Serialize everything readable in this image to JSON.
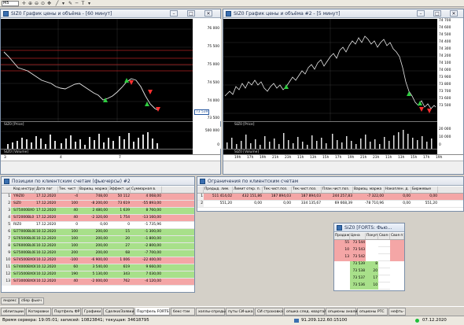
{
  "toolbar": {
    "interval": "M5"
  },
  "chart1": {
    "title": "SIZ0 График цены и объёма - [60 минут]",
    "price_ticks": [
      "76 000",
      "75 500",
      "75 000",
      "74 500",
      "74 000",
      "73 500"
    ],
    "last_price": "73 539",
    "price_label": "SIZ0 [Price]",
    "volume_ticks": [
      "500 000",
      "0"
    ],
    "volume_label": "SIZ0 [Volume]",
    "x_ticks": [
      "3",
      "4",
      "7"
    ]
  },
  "chart2": {
    "title": "SIZ0 График цены и объёма #2 - [5 минут]",
    "price_ticks": [
      "74 700",
      "74 600",
      "74 500",
      "74 400",
      "74 300",
      "74 200",
      "74 100",
      "74 000",
      "73 900",
      "73 800",
      "73 700",
      "73 600",
      "73 500"
    ],
    "price_label": "SIZ0 [Price]",
    "volume_ticks": [
      "20 000",
      "10 000",
      "0"
    ],
    "volume_label": "SIZ0 [Volume]",
    "x_ticks": [
      "19h",
      "17h",
      "19h",
      "21h",
      "23h",
      "11h",
      "13h",
      "15h",
      "17h",
      "19h",
      "21h",
      "23h",
      "11h",
      "13h",
      "15h",
      "17h",
      "19h"
    ]
  },
  "positions": {
    "title": "Позиции по клиентским счетам (фьючерсы) #2",
    "columns": [
      "Код инструм",
      "Дата пог",
      "Тек. чист",
      "Вариац. маржа",
      "Эффект. цена",
      "Суммарная в."
    ],
    "rows": [
      {
        "code": "Yl9ZI0",
        "date": "17.12.2020",
        "pos": "-4",
        "var": "748,00",
        "eff": "50 112",
        "sum": "4 068,00",
        "color": "red"
      },
      {
        "code": "SiZ0",
        "date": "17.12.2020",
        "pos": "100",
        "var": "-8 200,00",
        "eff": "73 619",
        "sum": "-55 893,00",
        "color": "red"
      },
      {
        "code": "Si75000BX0",
        "date": "17.12.2020",
        "pos": "40",
        "var": "2 480,00",
        "eff": "1 639",
        "sum": "8 760,00",
        "color": "green"
      },
      {
        "code": "Si72000BL0",
        "date": "17.12.2020",
        "pos": "40",
        "var": "-2 320,00",
        "eff": "1 754",
        "sum": "-13 160,00",
        "color": "red"
      },
      {
        "code": "RIZ0",
        "date": "17.12.2020",
        "pos": "0",
        "var": "0,00",
        "eff": "0",
        "sum": "-1 735,96",
        "color": "white"
      },
      {
        "code": "Si77000BL0B",
        "date": "10.12.2020",
        "pos": "100",
        "var": "200,00",
        "eff": "15",
        "sum": "-1 300,00",
        "color": "green"
      },
      {
        "code": "Si76500BL0B",
        "date": "10.12.2020",
        "pos": "100",
        "var": "200,00",
        "eff": "20",
        "sum": "-1 800,00",
        "color": "green"
      },
      {
        "code": "Si76000BL0B",
        "date": "10.12.2020",
        "pos": "100",
        "var": "200,00",
        "eff": "27",
        "sum": "-2 800,00",
        "color": "green"
      },
      {
        "code": "Si75000BL0B",
        "date": "10.12.2020",
        "pos": "200",
        "var": "200,00",
        "eff": "68",
        "sum": "-7 700,00",
        "color": "green"
      },
      {
        "code": "Si74500BX0B",
        "date": "10.12.2020",
        "pos": "-100",
        "var": "-6 900,00",
        "eff": "1 006",
        "sum": "-22 400,00",
        "color": "red"
      },
      {
        "code": "Si74000BX0B",
        "date": "10.12.2020",
        "pos": "60",
        "var": "3 540,00",
        "eff": "619",
        "sum": "9 660,00",
        "color": "green"
      },
      {
        "code": "Si73500BX0B",
        "date": "10.12.2020",
        "pos": "190",
        "var": "5 130,00",
        "eff": "343",
        "sum": "7 030,00",
        "color": "green"
      },
      {
        "code": "Si73000BX0B",
        "date": "10.12.2020",
        "pos": "40",
        "var": "-2 000,00",
        "eff": "762",
        "sum": "-4 120,00",
        "color": "red"
      }
    ]
  },
  "limits": {
    "title": "Ограничения по клиентским счетам",
    "columns": [
      "",
      "Предыд. лим.",
      "Лимит откр. п.",
      "Тек.чист.поз.",
      "Тек.чист.поз.",
      "План.чист.поз.",
      "Вариац. маржа",
      "Накоплен. д.",
      "Биржевые"
    ],
    "rows": [
      [
        "1",
        "511 414,02",
        "432 151,86",
        "187 894,03",
        "187 894,03",
        "244 257,83",
        "-7 322,00",
        "0,00",
        "0,00"
      ],
      [
        "2",
        "551,20",
        "0,00",
        "0,00",
        "334 135,67",
        "69 668,39",
        "-78 710,96",
        "0,00",
        "551,20"
      ]
    ]
  },
  "orderbook": {
    "title": "SiZ0 [FORTS: Фью...",
    "columns": [
      "Продаж",
      "Цена",
      "Покупк",
      "Своя п",
      "Своя п"
    ],
    "rows": [
      {
        "sell": "55",
        "price": "73 544",
        "buy": "",
        "side": "sell"
      },
      {
        "sell": "10",
        "price": "73 543",
        "buy": "",
        "side": "sell"
      },
      {
        "sell": "13",
        "price": "73 542",
        "buy": "",
        "side": "sell"
      },
      {
        "sell": "",
        "price": "73 539",
        "buy": "8",
        "side": "buy"
      },
      {
        "sell": "",
        "price": "73 538",
        "buy": "20",
        "side": "buy"
      },
      {
        "sell": "",
        "price": "73 537",
        "buy": "17",
        "side": "buy"
      },
      {
        "sell": "",
        "price": "73 536",
        "buy": "10",
        "side": "buy"
      }
    ]
  },
  "lower_tabs": [
    "яндекс",
    "сбер фьюч"
  ],
  "tabs": [
    "облигации",
    "Котировки",
    "Портфель ФР",
    "Графики",
    "Сделки/Заявки",
    "Портфель FORTS",
    "бекс-тэм",
    "холлы-спреды",
    "путы СИ-шка",
    "СИ страховка",
    "опшка след. квартал.",
    "опционы анализ",
    "опционы РТС",
    "нефть-"
  ],
  "active_tab": "Портфель FORTS",
  "status": {
    "server_time": "Время сервера: 19:05:01; записей: 10823841; текущая: 34618795",
    "ip": "91.209.122.60:15100",
    "date": "07.12.2020"
  }
}
